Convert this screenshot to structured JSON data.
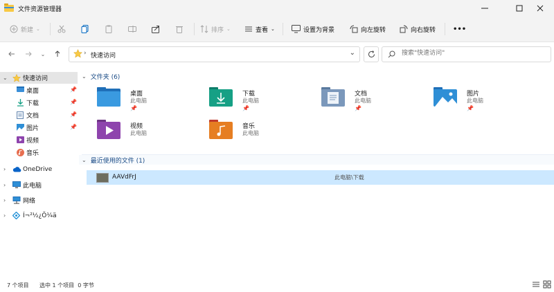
{
  "window": {
    "title": "文件资源管理器"
  },
  "toolbar": {
    "new_label": "新建",
    "sort_label": "排序",
    "view_label": "查看",
    "set_bg_label": "设置为背景",
    "rotate_left_label": "向左旋转",
    "rotate_right_label": "向右旋转",
    "more_label": "•••"
  },
  "address": {
    "crumb": "快速访问"
  },
  "search": {
    "placeholder": "搜索\"快速访问\""
  },
  "sidebar": {
    "quick_access": "快速访问",
    "items": [
      {
        "label": "桌面",
        "icon": "desktop-icon",
        "pinned": true
      },
      {
        "label": "下载",
        "icon": "download-icon",
        "pinned": true
      },
      {
        "label": "文档",
        "icon": "document-icon",
        "pinned": true
      },
      {
        "label": "图片",
        "icon": "picture-icon",
        "pinned": true
      },
      {
        "label": "视频",
        "icon": "video-icon",
        "pinned": false
      },
      {
        "label": "音乐",
        "icon": "music-icon",
        "pinned": false
      }
    ],
    "onedrive": "OneDrive",
    "this_pc": "此电脑",
    "network": "网络",
    "linux": "Í¬²½¿Õ¼ä"
  },
  "content": {
    "folders_header": "文件夹 (6)",
    "folders": [
      {
        "name": "桌面",
        "location": "此电脑",
        "pinned": true,
        "icon": "desktop-folder-icon"
      },
      {
        "name": "下载",
        "location": "此电脑",
        "pinned": true,
        "icon": "download-folder-icon"
      },
      {
        "name": "文档",
        "location": "此电脑",
        "pinned": true,
        "icon": "document-folder-icon"
      },
      {
        "name": "图片",
        "location": "此电脑",
        "pinned": true,
        "icon": "picture-folder-icon"
      },
      {
        "name": "视频",
        "location": "此电脑",
        "pinned": false,
        "icon": "video-folder-icon"
      },
      {
        "name": "音乐",
        "location": "此电脑",
        "pinned": false,
        "icon": "music-folder-icon"
      }
    ],
    "recent_header": "最近使用的文件 (1)",
    "recent_files": [
      {
        "name": "AAVdFrJ",
        "location": "此电脑\\下载"
      }
    ]
  },
  "status": {
    "count": "7 个项目",
    "selection": "选中 1 个项目  0 字节"
  },
  "colors": {
    "accent": "#0067c0",
    "selection": "#cce8ff",
    "folder_yellow": "#f8c945"
  }
}
